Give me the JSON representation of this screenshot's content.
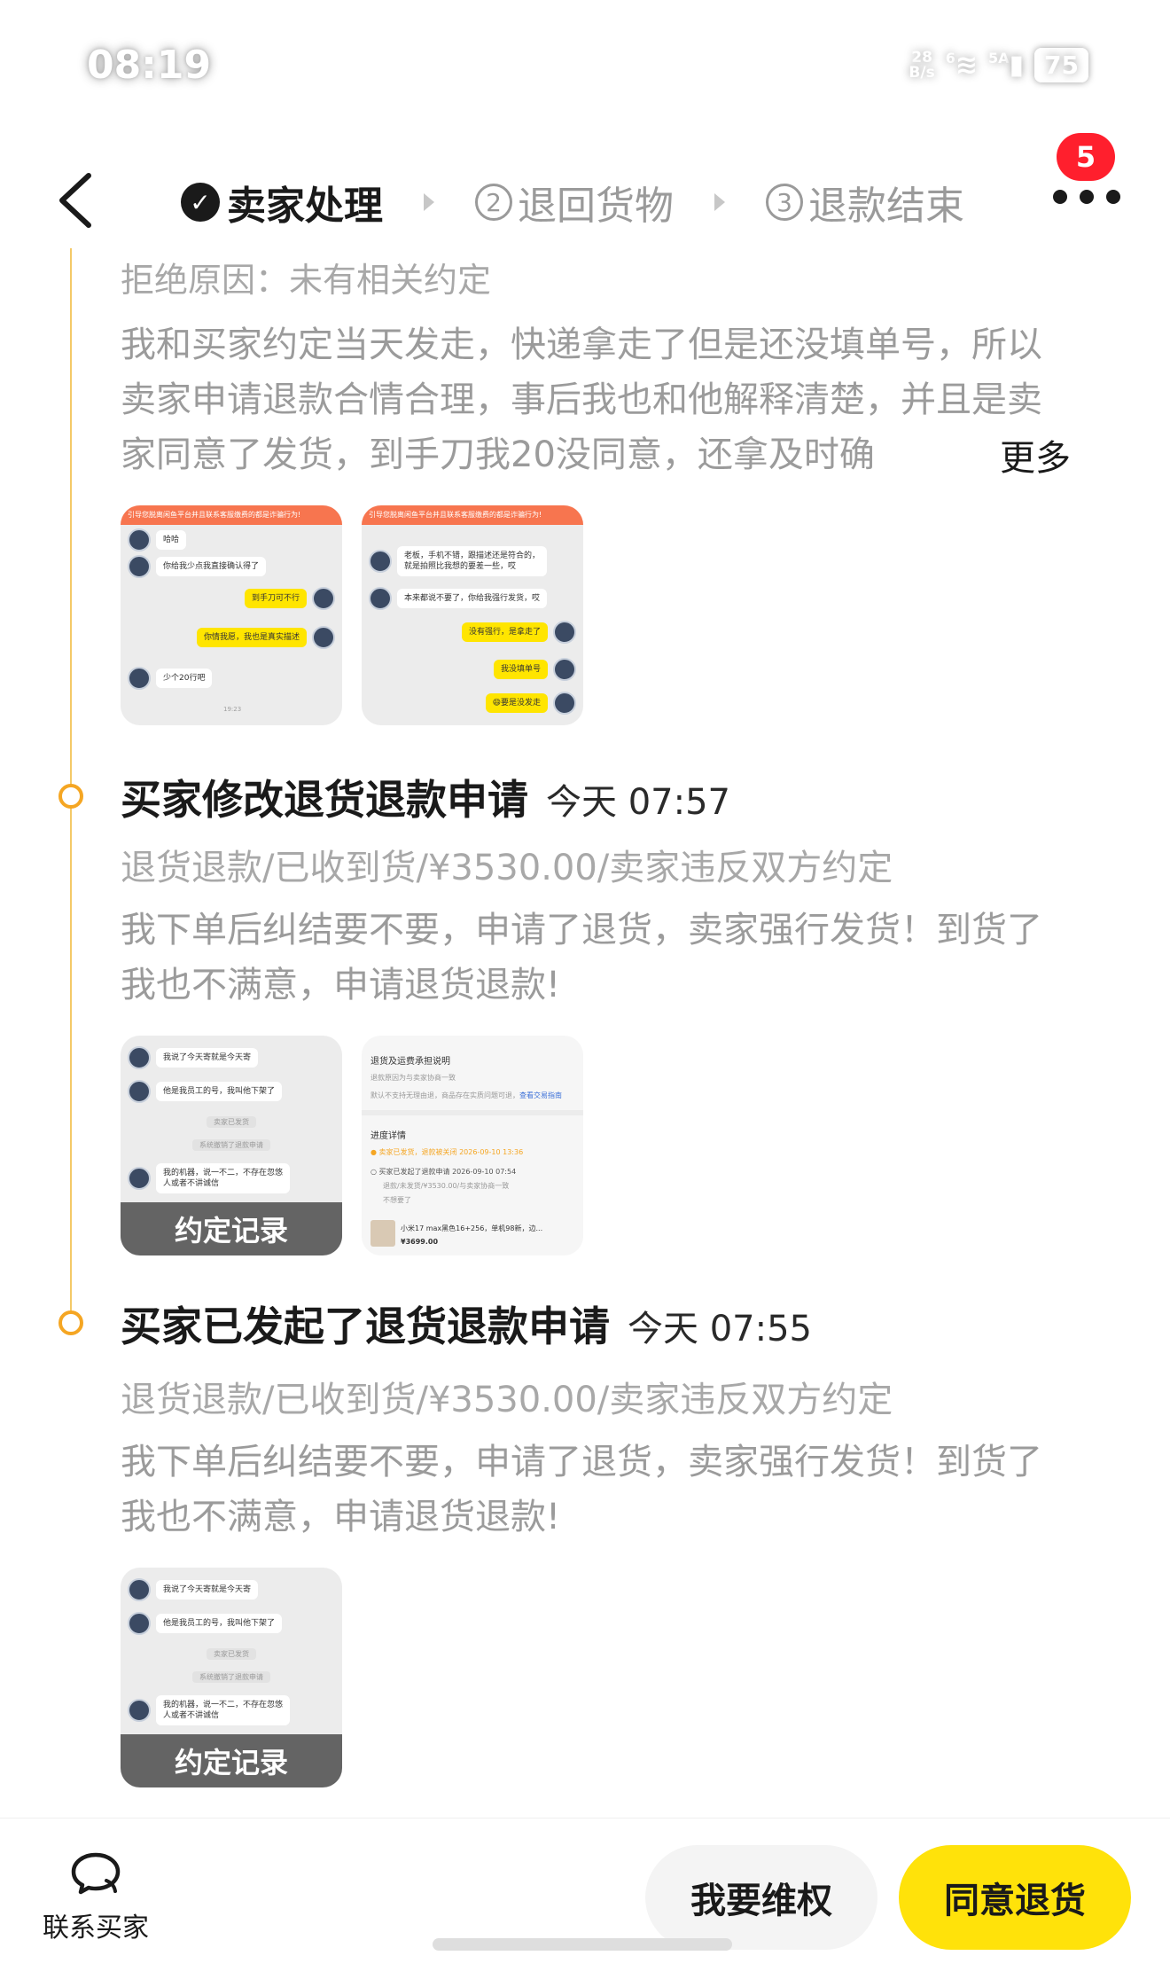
{
  "status_bar": {
    "time": "08:19",
    "net_speed_top": "28",
    "net_speed_bottom": "B/s",
    "wifi_label": "6",
    "signal_label": "5A",
    "battery": "75"
  },
  "nav": {
    "steps": [
      {
        "badge": "✓",
        "label": "卖家处理"
      },
      {
        "badge": "2",
        "label": "退回货物"
      },
      {
        "badge": "3",
        "label": "退款结束"
      }
    ],
    "notification_count": "5"
  },
  "top_entry": {
    "reason_line": "拒绝原因：未有相关约定",
    "text": "我和买家约定当天发走，快递拿走了但是还没填单号，所以卖家申请退款合情合理，事后我也和他解释清楚，并且是卖家同意了发货，到手刀我20没同意，还拿及时确",
    "more_label": "更多",
    "thumb1": {
      "banner": "引导您脱离闲鱼平台并且联系客服缴费的都是诈骗行为!",
      "msg1": "哈哈",
      "msg2": "你给我少点我直接确认得了",
      "msg3": "到手刀可不行",
      "msg4": "你情我愿，我也是真实描述",
      "msg5": "少个20行吧",
      "time": "19:23"
    },
    "thumb2": {
      "banner": "引导您脱离闲鱼平台并且联系客服缴费的都是诈骗行为!",
      "msg1a": "老板，手机不错，跟描述还是符合的，",
      "msg1b": "就是拍照比我想的要差一些，哎",
      "msg2": "本来都说不要了，你给我强行发货，哎",
      "msg3": "没有强行，是拿走了",
      "msg4": "我没填单号",
      "msg5": "😄要是没发走"
    }
  },
  "events": [
    {
      "title": "买家修改退货退款申请",
      "time": "今天 07:57",
      "subtitle": "退货退款/已收到货/¥3530.00/卖家违反双方约定",
      "text": "我下单后纠结要不要，申请了退货，卖家强行发货！到货了我也不满意，申请退货退款!",
      "chat_thumb": {
        "msg1": "我说了今天寄就是今天寄",
        "msg2": "他是我员工的号，我叫他下架了",
        "sys1": "卖家已发货",
        "sys2": "系统撤销了退款申请",
        "msg3a": "我的机器，说一不二，不存在忽悠",
        "msg3b": "人或者不讲诚信",
        "overlay": "约定记录"
      },
      "doc_thumb": {
        "title": "退货及运费承担说明",
        "line1": "退款原因为与卖家协商一致",
        "line2": "默认不支持无理由退，商品存在实质问题可退，",
        "link": "查看交易指南",
        "progress_title": "进度详情",
        "p1": "卖家已发货，退款被关闭 2026-09-10 13:36",
        "p2": "买家已发起了退款申请 2026-09-10 07:54",
        "p2b": "退款/未发货/¥3530.00/与卖家协商一致",
        "p2c": "不想要了",
        "product": "小米17 max黑色16+256，单机98新，边...",
        "price": "¥3699.00"
      }
    },
    {
      "title": "买家已发起了退货退款申请",
      "time": "今天 07:55",
      "subtitle": "退货退款/已收到货/¥3530.00/卖家违反双方约定",
      "text": "我下单后纠结要不要，申请了退货，卖家强行发货！到货了我也不满意，申请退货退款!",
      "chat_thumb": {
        "msg1": "我说了今天寄就是今天寄",
        "msg2": "他是我员工的号，我叫他下架了",
        "sys1": "卖家已发货",
        "sys2": "系统撤销了退款申请",
        "msg3a": "我的机器，说一不二，不存在忽悠",
        "msg3b": "人或者不讲诚信",
        "overlay": "约定记录"
      }
    }
  ],
  "bottom_bar": {
    "contact_label": "联系买家",
    "rights_button": "我要维权",
    "agree_button": "同意退货"
  },
  "colors": {
    "accent_yellow": "#ffe20a",
    "timeline_orange": "#f5a623",
    "badge_red": "#ff1f2d"
  }
}
